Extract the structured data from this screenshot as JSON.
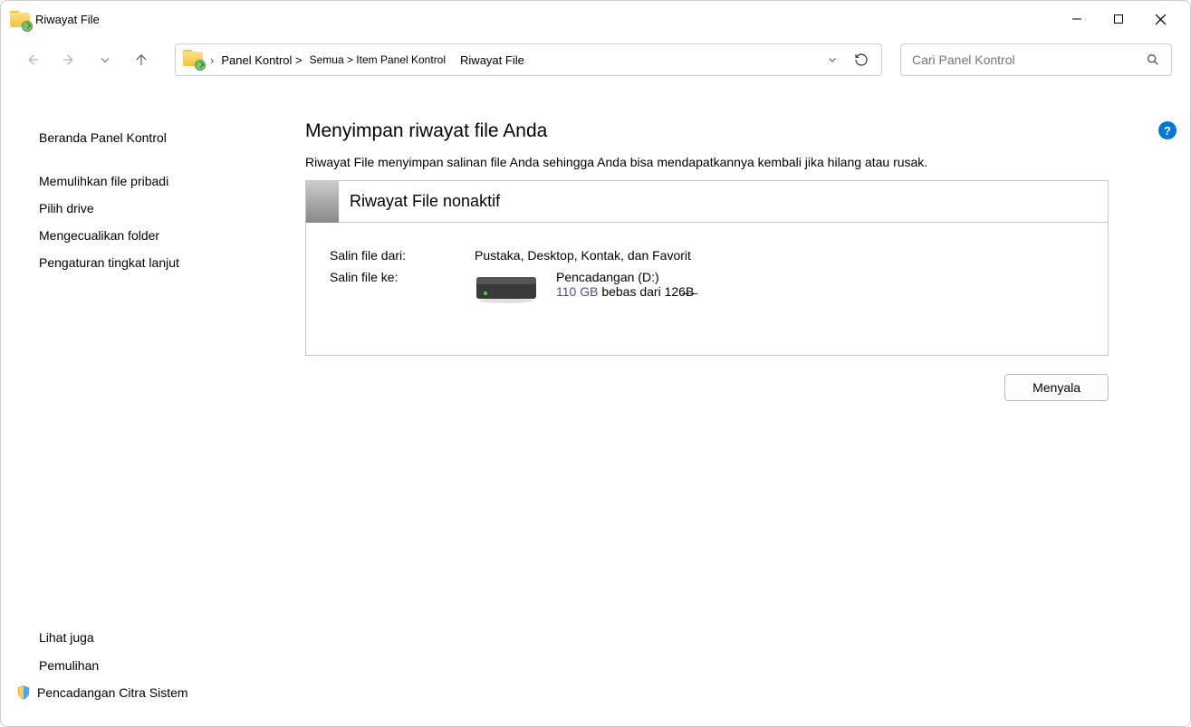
{
  "window": {
    "title": "Riwayat File"
  },
  "breadcrumb": {
    "seg1": "Panel Kontrol >",
    "seg2": "Semua > Item Panel Kontrol",
    "seg3": "Riwayat File"
  },
  "search": {
    "placeholder": "Cari Panel Kontrol"
  },
  "sidebar": {
    "home": "Beranda Panel Kontrol",
    "links": [
      "Memulihkan file pribadi",
      "Pilih drive",
      "Mengecualikan folder",
      "Pengaturan tingkat lanjut"
    ],
    "see_also_header": "Lihat juga",
    "see_also": [
      "Pemulihan",
      "Pencadangan Citra Sistem"
    ]
  },
  "main": {
    "heading": "Menyimpan riwayat file Anda",
    "subtitle": "Riwayat File menyimpan salinan file Anda sehingga Anda bisa mendapatkannya kembali jika hilang atau rusak.",
    "status_title": "Riwayat File nonaktif",
    "copy_from_label": "Salin file dari:",
    "copy_from_value": "Pustaka, Desktop, Kontak, dan Favorit",
    "copy_to_label": "Salin file ke:",
    "drive_name": "Pencadangan (D:)",
    "drive_free": "110 GB",
    "drive_rest": " bebas dari 126̶B̶",
    "button": "Menyala"
  },
  "help": {
    "glyph": "?"
  }
}
